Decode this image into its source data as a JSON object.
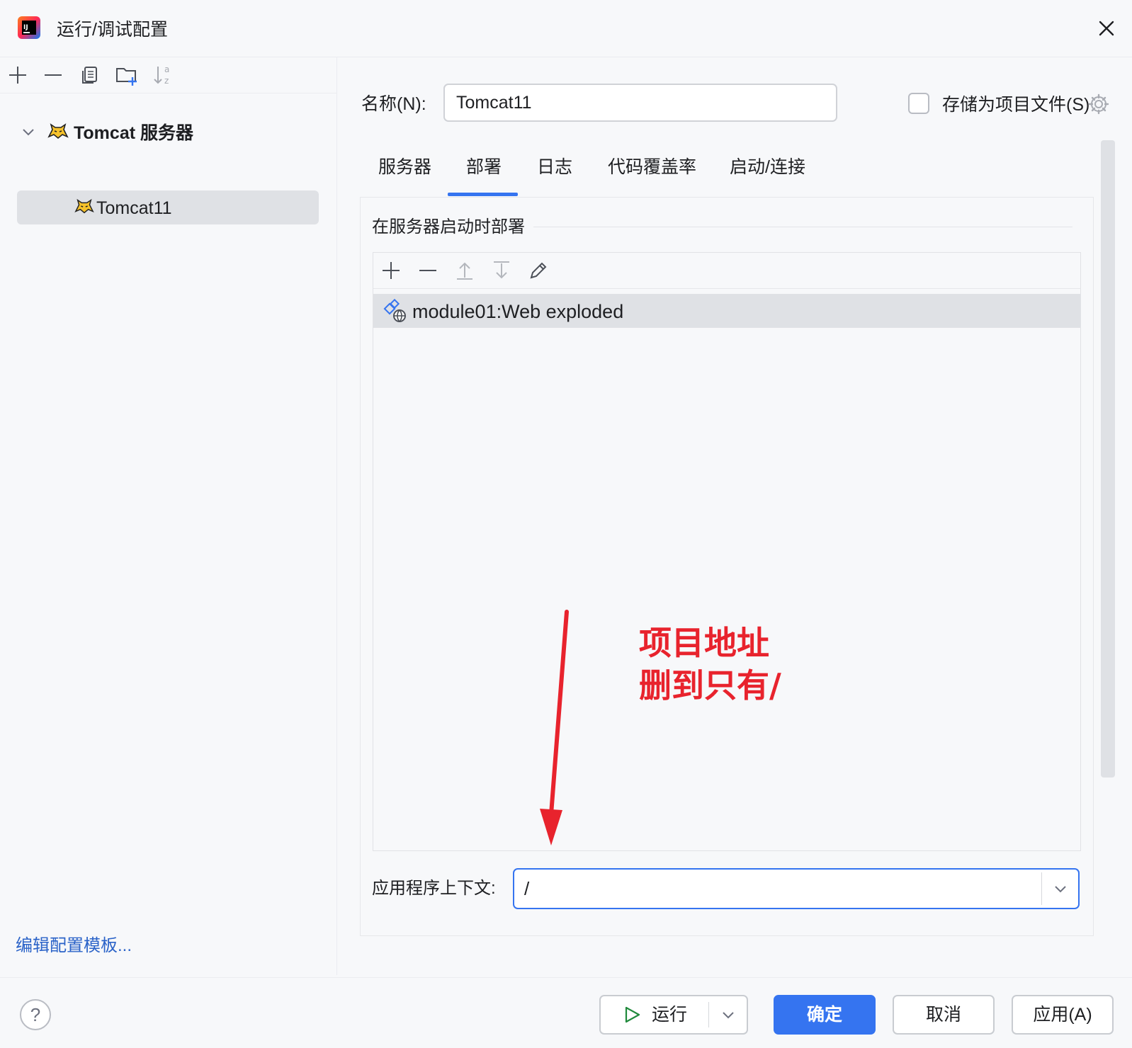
{
  "window": {
    "title": "运行/调试配置"
  },
  "sidebar": {
    "tree": {
      "group_label": "Tomcat 服务器",
      "item_label": "Tomcat11"
    },
    "edit_templates_link": "编辑配置模板..."
  },
  "form": {
    "name_label": "名称(N):",
    "name_value": "Tomcat11",
    "store_as_project_file_label": "存储为项目文件(S)",
    "store_as_project_file_checked": false
  },
  "tabs": [
    {
      "label": "服务器",
      "active": false
    },
    {
      "label": "部署",
      "active": true
    },
    {
      "label": "日志",
      "active": false
    },
    {
      "label": "代码覆盖率",
      "active": false
    },
    {
      "label": "启动/连接",
      "active": false
    }
  ],
  "deployment": {
    "section_title": "在服务器启动时部署",
    "items": [
      {
        "label": "module01:Web exploded",
        "selected": true
      }
    ],
    "context_label": "应用程序上下文:",
    "context_value": "/"
  },
  "annotation": {
    "line1": "项目地址",
    "line2": "删到只有/",
    "color": "#e8232d"
  },
  "footer": {
    "help_symbol": "?",
    "run_label": "运行",
    "ok_label": "确定",
    "cancel_label": "取消",
    "apply_label": "应用(A)"
  },
  "colors": {
    "accent": "#3574f0",
    "background": "#f7f8fa",
    "selection": "#dfe1e5",
    "link": "#2b63c8"
  }
}
